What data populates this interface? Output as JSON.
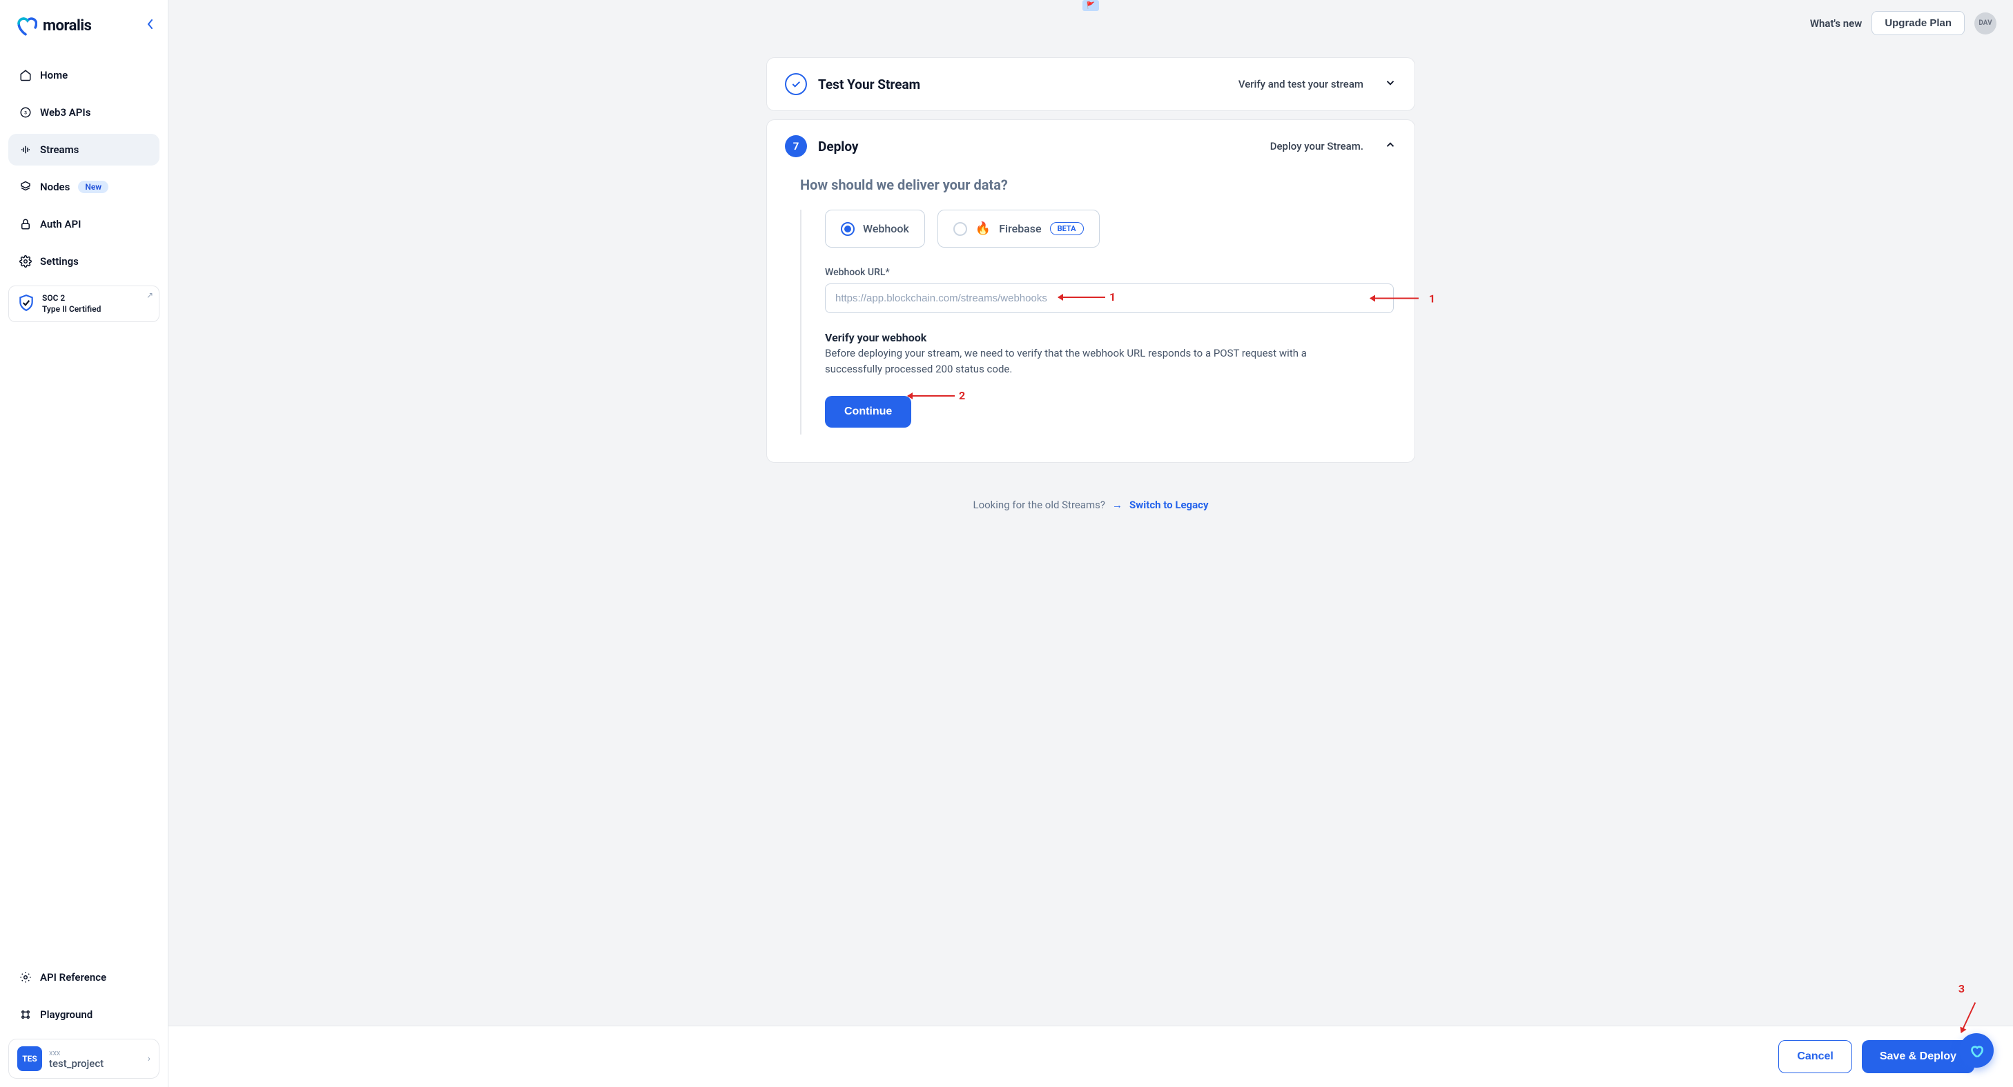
{
  "brand": "moralis",
  "header": {
    "whats_new": "What's new",
    "upgrade": "Upgrade Plan",
    "avatar": "DAV"
  },
  "sidebar": {
    "items": [
      {
        "label": "Home"
      },
      {
        "label": "Web3 APIs"
      },
      {
        "label": "Streams"
      },
      {
        "label": "Nodes",
        "badge": "New"
      },
      {
        "label": "Auth API"
      },
      {
        "label": "Settings"
      }
    ],
    "soc2_line1": "SOC 2",
    "soc2_line2": "Type II Certified",
    "secondary": [
      {
        "label": "API Reference"
      },
      {
        "label": "Playground"
      }
    ],
    "project": {
      "badge": "TES",
      "small": "xxx",
      "name": "test_project"
    }
  },
  "steps": {
    "test": {
      "title": "Test Your Stream",
      "sub": "Verify and test your stream"
    },
    "deploy": {
      "num": "7",
      "title": "Deploy",
      "sub": "Deploy your Stream."
    }
  },
  "deploy": {
    "heading": "How should we deliver your data?",
    "option_webhook": "Webhook",
    "option_firebase": "Firebase",
    "beta": "BETA",
    "field_label": "Webhook URL*",
    "placeholder": "https://app.blockchain.com/streams/webhooks",
    "verify_title": "Verify your webhook",
    "verify_desc": "Before deploying your stream, we need to verify that the webhook URL responds to a POST request with a successfully processed 200 status code.",
    "continue": "Continue"
  },
  "legacy": {
    "question": "Looking for the old Streams?",
    "arrow": "→",
    "link": "Switch to Legacy"
  },
  "footer": {
    "cancel": "Cancel",
    "save": "Save & Deploy"
  },
  "annotations": {
    "a1": "1",
    "a2": "2",
    "a3": "3"
  }
}
